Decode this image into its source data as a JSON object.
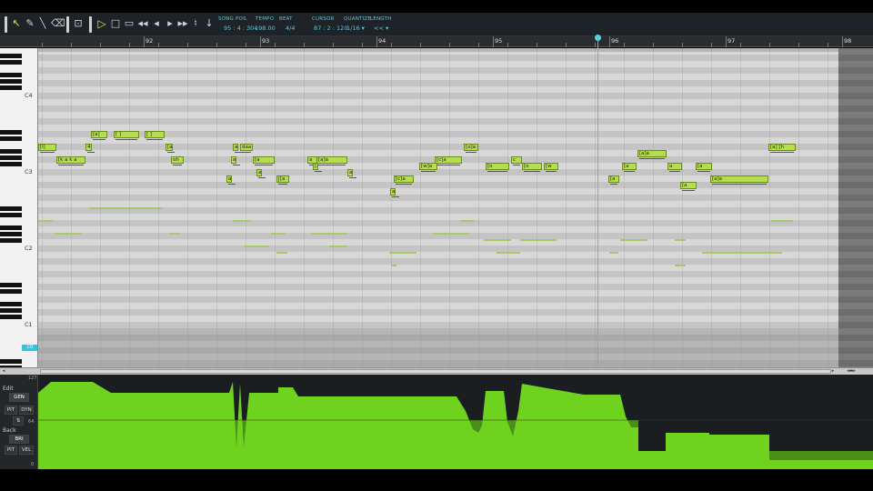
{
  "toolbar": {
    "tools": [
      {
        "icon": "arrow-select-icon",
        "glyph": "↖",
        "selected": true
      },
      {
        "icon": "pencil-icon",
        "glyph": "✎"
      },
      {
        "icon": "line-icon",
        "glyph": "╲"
      },
      {
        "icon": "eraser-icon",
        "glyph": "⌫"
      },
      {
        "icon": "grid-snap-icon",
        "glyph": "⊡"
      },
      {
        "icon": "play-icon",
        "glyph": "▷"
      },
      {
        "icon": "stop-icon",
        "glyph": "□"
      },
      {
        "icon": "loop-icon",
        "glyph": "▭"
      },
      {
        "icon": "rewind-icon",
        "glyph": "◂◂"
      },
      {
        "icon": "back-icon",
        "glyph": "◂"
      },
      {
        "icon": "forward-icon",
        "glyph": "▸"
      },
      {
        "icon": "fast-forward-icon",
        "glyph": "▸▸"
      },
      {
        "icon": "metronome-icon",
        "glyph": "♮"
      },
      {
        "icon": "auto-scroll-icon",
        "glyph": "↓"
      }
    ],
    "song_pos_label": "SONG POS.",
    "song_pos_value": "95 : 4 : 304",
    "tempo_label": "TEMPO",
    "tempo_value": "198.00",
    "beat_label": "BEAT",
    "beat_value": "4/4",
    "cursor_label": "CURSOR",
    "cursor_value": "87 : 2 : 120",
    "quantize_label": "QUANTIZE",
    "quantize_value": "1/16 ▾",
    "length_label": "LENGTH",
    "length_value": "<< ▾"
  },
  "ruler": {
    "measures": [
      "92",
      "93",
      "94",
      "95",
      "96",
      "97",
      "98"
    ]
  },
  "piano": {
    "octaves": [
      "C4",
      "C3",
      "C2",
      "C1"
    ],
    "current_key": "C0"
  },
  "notes": [
    {
      "lyric": "[l]",
      "row": 14
    },
    {
      "lyric": "[k a  k a",
      "row": 16
    },
    {
      "lyric": "[a]",
      "row": 12
    },
    {
      "lyric": "[ ]",
      "row": 12
    },
    {
      "lyric": "[ ]",
      "row": 12
    },
    {
      "lyric": "4",
      "row": 14
    },
    {
      "lyric": "[a",
      "row": 14
    },
    {
      "lyric": "oh",
      "row": 16
    },
    {
      "lyric": "a",
      "row": 14
    },
    {
      "lyric": "daa",
      "row": 14
    },
    {
      "lyric": "a",
      "row": 16
    },
    {
      "lyric": "[a",
      "row": 16
    },
    {
      "lyric": "a",
      "row": 19
    },
    {
      "lyric": "a",
      "row": 16
    },
    {
      "lyric": "[a]a",
      "row": 16
    },
    {
      "lyric": "[a",
      "row": 17
    },
    {
      "lyric": "a",
      "row": 18
    },
    {
      "lyric": "a",
      "row": 19
    },
    {
      "lyric": "[a",
      "row": 19
    },
    {
      "lyric": "a",
      "row": 18
    },
    {
      "lyric": "[c]a",
      "row": 19
    },
    {
      "lyric": "a",
      "row": 21
    },
    {
      "lyric": "[w]a",
      "row": 17
    },
    {
      "lyric": "[c]a",
      "row": 16
    },
    {
      "lyric": "[o]a",
      "row": 14
    },
    {
      "lyric": "[o",
      "row": 17
    },
    {
      "lyric": "c",
      "row": 16
    },
    {
      "lyric": "[o",
      "row": 17
    },
    {
      "lyric": "[w",
      "row": 17
    },
    {
      "lyric": "[a",
      "row": 19
    },
    {
      "lyric": "[a",
      "row": 17
    },
    {
      "lyric": "[a]a",
      "row": 15
    },
    {
      "lyric": "a",
      "row": 17
    },
    {
      "lyric": "[a",
      "row": 17
    },
    {
      "lyric": "[a",
      "row": 20
    },
    {
      "lyric": "[a]a",
      "row": 19
    },
    {
      "lyric": "[a]  [h",
      "row": 14
    }
  ],
  "param_panel": {
    "edit_label": "Edit",
    "edit_param": "GEN",
    "back_label": "Back",
    "back_param": "BRI",
    "buttons_top": [
      "PIT",
      "DYN"
    ],
    "buttons_bottom": [
      "PIT",
      "VEL"
    ],
    "scale_max": "127",
    "scale_mid": "64",
    "scale_min": "0",
    "fill_color": "#6fd21f",
    "back_color": "#4a8f18"
  },
  "colors": {
    "note": "#b3e04a",
    "playhead": "#3ec8e0",
    "accent_text": "#5fc6dd"
  }
}
